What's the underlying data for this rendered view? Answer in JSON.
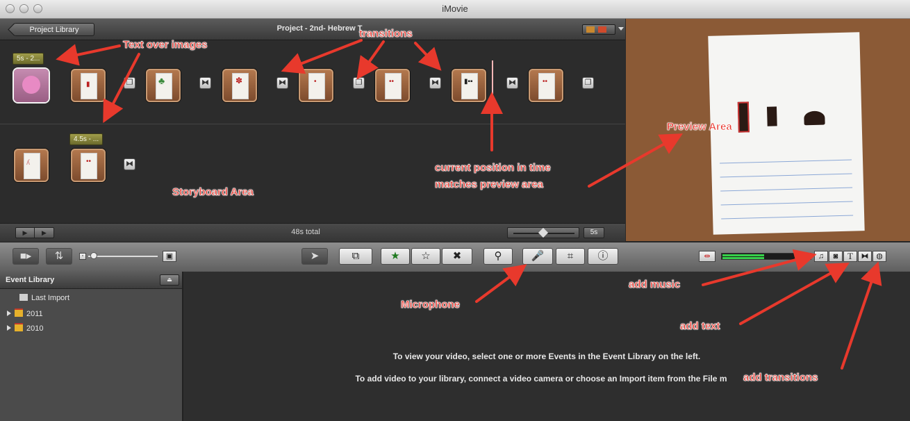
{
  "window": {
    "title": "iMovie"
  },
  "project": {
    "back_button": "Project Library",
    "title": "Project - 2nd- Hebrew T",
    "total_duration": "48s total",
    "zoom_value": "5s",
    "text_tags": [
      "5s - 2...",
      "4.5s - ..."
    ]
  },
  "event_library": {
    "title": "Event Library",
    "items": [
      "Last Import",
      "2011",
      "2010"
    ]
  },
  "event_viewer": {
    "line1": "To view your video, select one or more Events in the Event Library on the left.",
    "line2": "To add video to your library, connect a video camera or choose an Import item from the File m"
  },
  "annotations": {
    "text_over_images": "Text over images",
    "transitions": "transitions",
    "storyboard_area": "Storyboard Area",
    "current_position_1": "current position in time",
    "current_position_2": "matches preview area",
    "preview_area": "Preview Area",
    "microphone": "Microphone",
    "add_music": "add music",
    "add_text": "add text",
    "add_transitions": "add transitions"
  },
  "toolbar": {
    "icons": {
      "camera": "camera-icon",
      "swap": "swap-icon",
      "select": "pointer-icon",
      "crop_add": "add-to-project-icon",
      "favorite": "star-filled-icon",
      "unmark": "star-outline-icon",
      "reject": "reject-x-icon",
      "keyword": "key-icon",
      "microphone": "microphone-icon",
      "crop": "crop-icon",
      "info": "info-icon",
      "music": "music-note-icon",
      "photo": "camera-photo-icon",
      "title": "text-t-icon",
      "transition": "transition-icon",
      "map": "globe-icon"
    },
    "audio_level_color": "#37d04a"
  },
  "colors": {
    "annotation": "#e8332a",
    "annotation_arrow": "#e8392c"
  }
}
